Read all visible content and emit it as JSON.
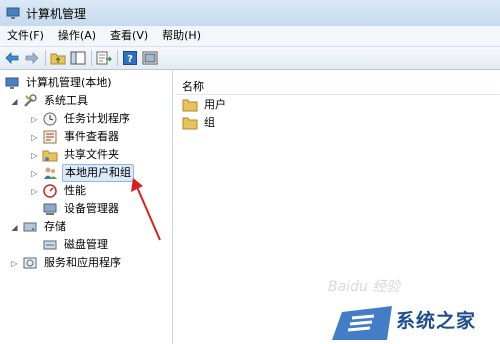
{
  "window": {
    "title": "计算机管理"
  },
  "menu": [
    "文件(F)",
    "操作(A)",
    "查看(V)",
    "帮助(H)"
  ],
  "tree": {
    "root": "计算机管理(本地)",
    "system_tools": "系统工具",
    "task_scheduler": "任务计划程序",
    "event_viewer": "事件查看器",
    "shared_folders": "共享文件夹",
    "local_users_groups": "本地用户和组",
    "performance": "性能",
    "device_manager": "设备管理器",
    "storage": "存储",
    "disk_management": "磁盘管理",
    "services_apps": "服务和应用程序"
  },
  "list": {
    "column_name": "名称",
    "items": [
      "用户",
      "组"
    ]
  },
  "watermark": {
    "text": "系统之家",
    "faint": "Baidu 经验"
  },
  "colors": {
    "selection": "#dbe9f9",
    "arrow": "#d9201f",
    "folder": "#e8c25a"
  }
}
